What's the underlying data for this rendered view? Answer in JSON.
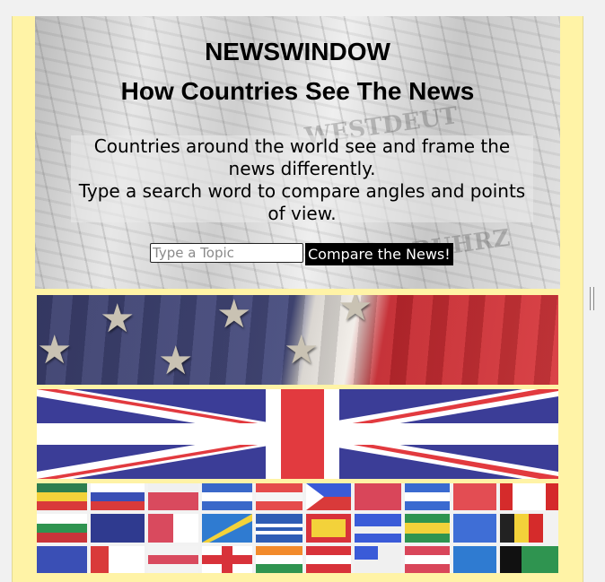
{
  "header": {
    "brand": "NEWSWINDOW",
    "subtitle": "How Countries See The News"
  },
  "description": {
    "line1": "Countries around the world see and frame the news differently.",
    "line2": "Type a search word to compare angles and points of view."
  },
  "search": {
    "placeholder": "Type a Topic",
    "value": "",
    "button_label": "Compare the News!"
  },
  "flags": [
    {
      "name": "usa-flag-banner",
      "icon": "us-flag"
    },
    {
      "name": "uk-flag-banner",
      "icon": "uk-flag"
    },
    {
      "name": "world-flags-banner",
      "icon": "world-flags"
    }
  ],
  "colors": {
    "page_background": "#fff3a6",
    "button_bg": "#000000",
    "button_text": "#ffffff",
    "uk_blue": "#3b3d97",
    "uk_red": "#e23a3f"
  }
}
